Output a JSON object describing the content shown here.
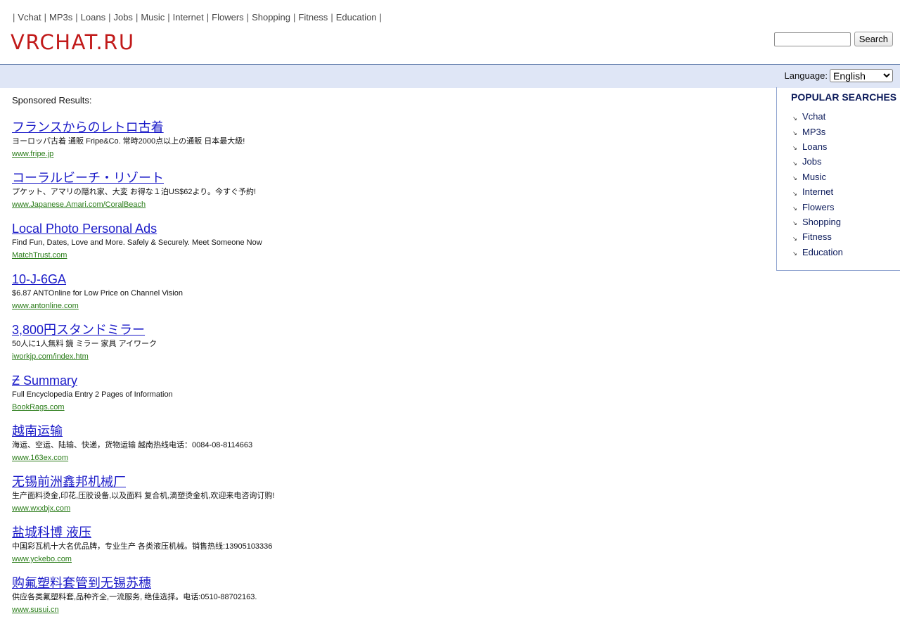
{
  "nav": {
    "separator": "|",
    "items": [
      "Vchat",
      "MP3s",
      "Loans",
      "Jobs",
      "Music",
      "Internet",
      "Flowers",
      "Shopping",
      "Fitness",
      "Education"
    ]
  },
  "logo": "VRCHAT.RU",
  "search": {
    "value": "",
    "button_label": "Search"
  },
  "language": {
    "label": "Language:",
    "selected": "English"
  },
  "sponsored_label": "Sponsored Results:",
  "results": [
    {
      "title": "フランスからのレトロ古着",
      "desc": "ヨーロッパ古着 通販 Fripe&Co. 常時2000点以上の通販 日本最大級!",
      "url": "www.fripe.jp"
    },
    {
      "title": "コーラルビーチ・リゾート",
      "desc": "プケット、アマリの隠れ家、大変 お得な１泊US$62より。今すぐ予約!",
      "url": "www.Japanese.Amari.com/CoralBeach"
    },
    {
      "title": "Local Photo Personal Ads",
      "desc": "Find Fun, Dates, Love and More. Safely & Securely. Meet Someone Now",
      "url": "MatchTrust.com"
    },
    {
      "title": "10-J-6GA",
      "desc": "$6.87 ANTOnline for Low Price on Channel Vision",
      "url": "www.antonline.com"
    },
    {
      "title": "3,800円スタンドミラー",
      "desc": "50人に1人無料 鏡 ミラー 家具 アイワーク",
      "url": "iworkjp.com/index.htm"
    },
    {
      "title": "Ƶ Summary",
      "desc": "Full Encyclopedia Entry 2 Pages of Information",
      "url": "BookRags.com"
    },
    {
      "title": "越南运输",
      "desc": "海运、空运、陆输、快递，货物运输 越南热线电话：0084-08-8114663",
      "url": "www.163ex.com"
    },
    {
      "title": "无锡前洲鑫邦机械厂",
      "desc": "生产面料烫金,印花,压胶设备,以及面料 复合机,滴塑烫金机,欢迎来电咨询订购!",
      "url": "www.wxxbjx.com"
    },
    {
      "title": "盐城科博 液压",
      "desc": "中国彩瓦机十大名优品牌，专业生产 各类液压机械。销售热线:13905103336",
      "url": "www.yckebo.com"
    },
    {
      "title": "购氟塑料套管到无锡苏穗",
      "desc": "供应各类氟塑料套,品种齐全,一流服务, 绝佳选择。电话:0510-88702163.",
      "url": "www.susui.cn"
    }
  ],
  "popular": {
    "heading": "POPULAR SEARCHES",
    "items": [
      "Vchat",
      "MP3s",
      "Loans",
      "Jobs",
      "Music",
      "Internet",
      "Flowers",
      "Shopping",
      "Fitness",
      "Education"
    ]
  }
}
